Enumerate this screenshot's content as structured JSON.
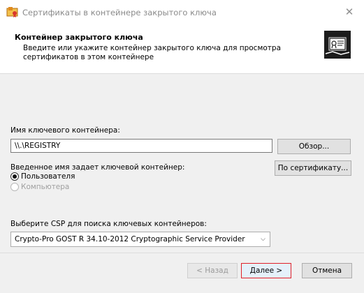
{
  "window": {
    "title": "Сертификаты в контейнере закрытого ключа"
  },
  "header": {
    "title": "Контейнер закрытого ключа",
    "description": "Введите или укажите контейнер закрытого ключа для просмотра сертификатов в этом контейнере"
  },
  "form": {
    "container_label": "Имя ключевого контейнера:",
    "container_value": "\\\\.\\REGISTRY",
    "browse_button": "Обзор...",
    "info_text": "Введенное имя задает ключевой контейнер:",
    "by_cert_button": "По сертификату...",
    "radio_user": "Пользователя",
    "radio_computer": "Компьютера",
    "csp_label": "Выберите CSP для поиска ключевых контейнеров:",
    "csp_selected": "Crypto-Pro GOST R 34.10-2012 Cryptographic Service Provider"
  },
  "footer": {
    "back_button": "< Назад",
    "next_button": "Далее >",
    "cancel_button": "Отмена"
  },
  "colors": {
    "highlight": "#e0202a",
    "app_icon": "#e08a1e"
  }
}
